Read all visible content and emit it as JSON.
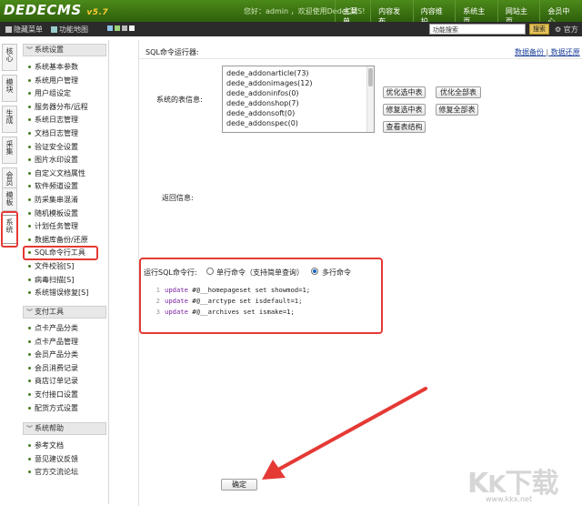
{
  "header": {
    "logo": "DEDECMS",
    "version": "v5.7",
    "welcome": "您好：admin ，欢迎使用DedeCMS!",
    "nav": [
      "主菜单",
      "内容发布",
      "内容维护",
      "系统主页",
      "网站主页",
      "会员中心"
    ]
  },
  "subbar": {
    "hide_menu": "隐藏菜单",
    "func_map": "功能地图",
    "search_value": "功能搜索",
    "search_button": "搜索",
    "right_text": "官方"
  },
  "vtabs": [
    "核心",
    "模块",
    "生成",
    "采集",
    "会员",
    "模板",
    "系统"
  ],
  "sidebar": {
    "sections": [
      {
        "title": "系统设置",
        "items": [
          "系统基本参数",
          "系统用户管理",
          "用户组设定",
          "服务器分布/远程",
          "系统日志管理",
          "文档日志管理",
          "验证安全设置",
          "图片水印设置",
          "自定义文档属性",
          "软件频道设置",
          "防采集串混淆",
          "随机模板设置",
          "计划任务管理",
          "数据库备份/还原",
          "SQL命令行工具",
          "文件校验[S]",
          "病毒扫描[S]",
          "系统错误修复[S]"
        ]
      },
      {
        "title": "支付工具",
        "items": [
          "点卡产品分类",
          "点卡产品管理",
          "会员产品分类",
          "会员消费记录",
          "商店订单记录",
          "支付接口设置",
          "配货方式设置"
        ]
      },
      {
        "title": "系统帮助",
        "items": [
          "参考文档",
          "意见建议反馈",
          "官方交流论坛"
        ]
      }
    ]
  },
  "main": {
    "title": "SQL命令运行器:",
    "link_backup": "数据备份",
    "link_sep": "|",
    "link_restore": "数据还原",
    "tables_label": "系统的表信息:",
    "tables": [
      "dede_addonarticle(73)",
      "dede_addonimages(12)",
      "dede_addoninfos(0)",
      "dede_addonshop(7)",
      "dede_addonsoft(0)",
      "dede_addonspec(0)"
    ],
    "buttons": {
      "optimize_selected": "优化选中表",
      "optimize_all": "优化全部表",
      "repair_selected": "修复选中表",
      "repair_all": "修复全部表",
      "view_structure": "查看表结构"
    },
    "return_label": "返回信息:",
    "run_label": "运行SQL命令行:",
    "radio_single": "单行命令（支持简单查询）",
    "radio_multi": "多行命令",
    "code_lines": [
      {
        "n": "1",
        "kw": "update",
        "rest": " #@__homepageset set showmod=1;"
      },
      {
        "n": "2",
        "kw": "update",
        "rest": " #@__arctype set isdefault=1;"
      },
      {
        "n": "3",
        "kw": "update",
        "rest": " #@__archives set ismake=1;"
      }
    ],
    "ok_button": "确定"
  },
  "watermark": {
    "text": "KK下载",
    "url": "www.kkx.net"
  },
  "colors": {
    "header_green": "#3b6e12",
    "highlight_red": "#e53935",
    "link_blue": "#1d3f9a"
  }
}
